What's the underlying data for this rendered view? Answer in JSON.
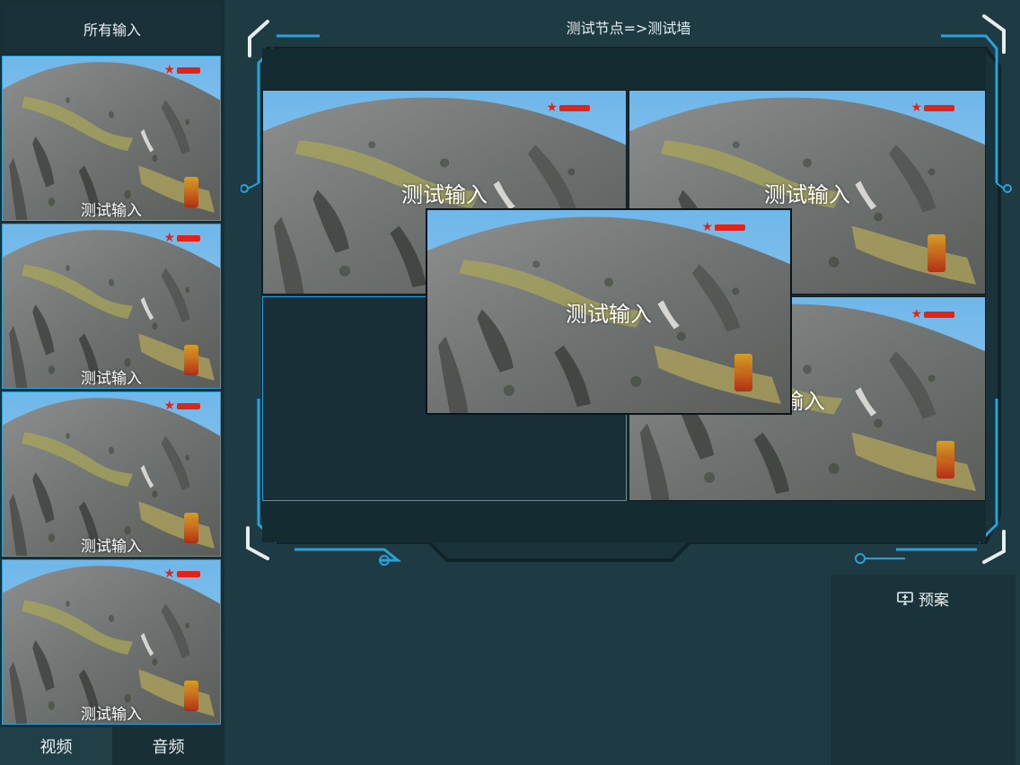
{
  "left_panel": {
    "title": "所有输入",
    "inputs": [
      {
        "label": "测试输入"
      },
      {
        "label": "测试输入"
      },
      {
        "label": "测试输入"
      },
      {
        "label": "测试输入"
      }
    ],
    "tabs": [
      {
        "label": "视频",
        "active": true
      },
      {
        "label": "音频",
        "active": false
      }
    ]
  },
  "main": {
    "title": "测试节点=>测试墙",
    "cells": [
      {
        "label": "测试输入"
      },
      {
        "label": "测试输入"
      },
      {
        "label": ""
      },
      {
        "label": "输入"
      }
    ],
    "floating_window": {
      "label": "测试输入"
    }
  },
  "plan_panel": {
    "title": "预案",
    "icon": "monitor-icon"
  },
  "colors": {
    "accent": "#2aa2d8",
    "background": "#1e3a42",
    "panel": "#182f36"
  }
}
